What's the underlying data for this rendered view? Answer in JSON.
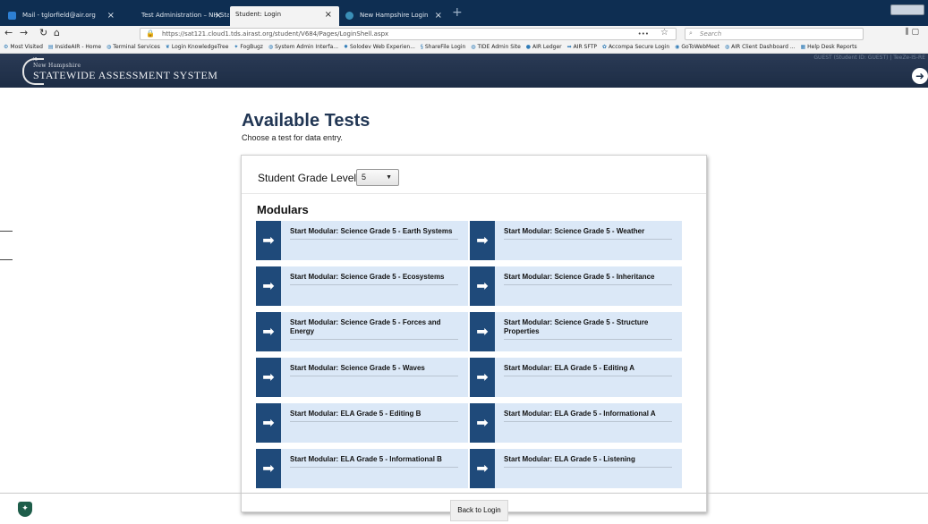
{
  "browser": {
    "tabs": [
      {
        "label": "Mail - tglorfield@air.org",
        "close": "×"
      },
      {
        "label": "Test Administration – NH Stat",
        "close": "×"
      },
      {
        "label": "Student: Login",
        "close": "×"
      },
      {
        "label": "New Hampshire Login",
        "close": "×"
      }
    ],
    "new_tab": "+",
    "url": "https://sat121.cloud1.tds.airast.org/student/V684/Pages/LoginShell.aspx",
    "url_menu": "•••",
    "search_placeholder": "Search",
    "bookmarks": [
      "Most Visited",
      "InsideAIR - Home",
      "Terminal Services",
      "Login KnowledgeTree",
      "FogBugz",
      "System Admin Interfa...",
      "Solodev Web Experien...",
      "ShareFile Login",
      "TIDE Admin Site",
      "AIR Ledger",
      "AIR SFTP",
      "Accompa Secure Login",
      "GoToWebMeet",
      "AIR Client Dashboard ...",
      "Help Desk Reports"
    ]
  },
  "header": {
    "brand_top": "New Hampshire",
    "brand_main": "STATEWIDE ASSESSMENT SYSTEM",
    "user_info": "GUEST (Student ID: GUEST) | TeeZe-IS-RE"
  },
  "page": {
    "title": "Available Tests",
    "subtitle": "Choose a test for data entry.",
    "grade_label": "Student Grade Level:",
    "grade_value": "5",
    "section_title": "Modulars",
    "tests": [
      "Start Modular: Science Grade 5 - Earth Systems",
      "Start Modular: Science Grade 5 - Weather",
      "Start Modular: Science Grade 5 - Ecosystems",
      "Start Modular: Science Grade 5 - Inheritance",
      "Start Modular: Science Grade 5 - Forces and Energy",
      "Start Modular: Science Grade 5 - Structure Properties",
      "Start Modular: Science Grade 5 - Waves",
      "Start Modular: ELA Grade 5 - Editing A",
      "Start Modular: ELA Grade 5 - Editing B",
      "Start Modular: ELA Grade 5 - Informational A",
      "Start Modular: ELA Grade 5 - Informational B",
      "Start Modular: ELA Grade 5 - Listening"
    ]
  },
  "footer": {
    "back_label": "Back to Login"
  },
  "colors": {
    "header_bg": "#22334c",
    "tile_bg": "#dbe8f7",
    "tile_arrow": "#1f4a7a",
    "title": "#213654"
  }
}
